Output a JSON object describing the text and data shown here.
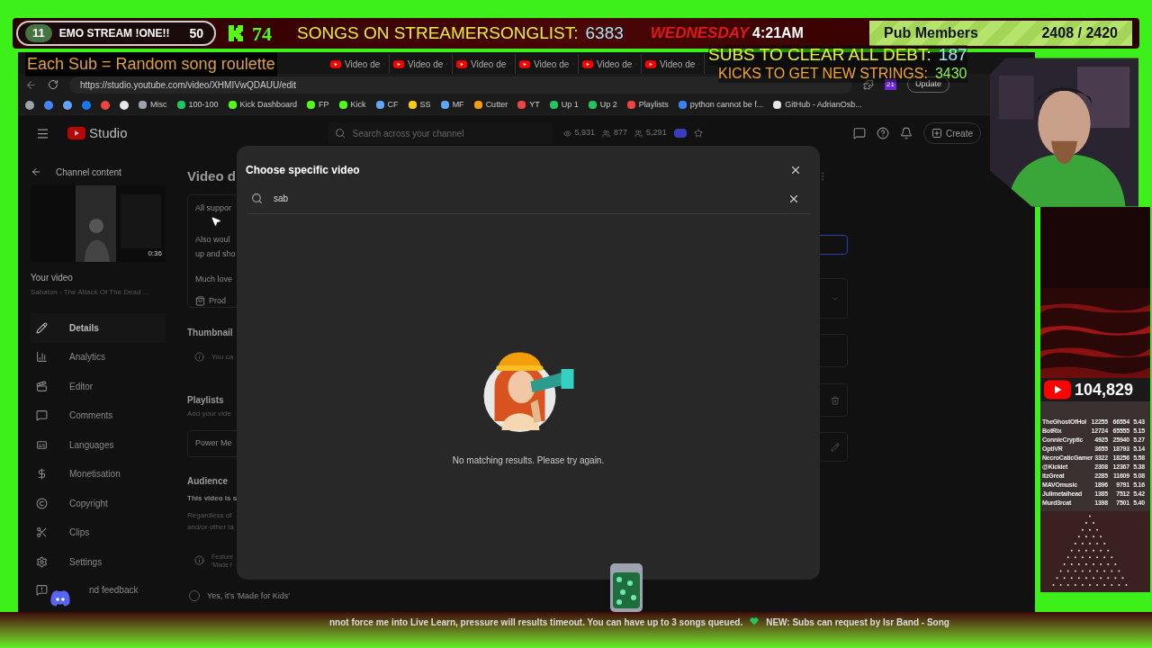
{
  "stream_bar": {
    "level_badge": "11",
    "title": "EMO STREAM !ONE!!",
    "title_count": "50",
    "kick_count": "74",
    "songs_label": "SONGS ON STREAMERSONGLIST:",
    "songs_count": "6383",
    "day": "WEDNESDAY",
    "time": "4:21AM",
    "members_label": "Pub Members",
    "members_count": "2408 / 2420"
  },
  "overlay_notes": {
    "roulette": "Each Sub = Random song roulette",
    "debt_label": "SUBS TO CLEAR ALL DEBT:",
    "debt_value": "187",
    "strings_label": "KICKS TO GET NEW STRINGS:",
    "strings_value": "3430"
  },
  "browser": {
    "tabs": [
      {
        "label": "Video de"
      },
      {
        "label": "Video de"
      },
      {
        "label": "Video de"
      },
      {
        "label": "Video de"
      },
      {
        "label": "Video de"
      },
      {
        "label": "Video de"
      }
    ],
    "url": "https://studio.youtube.com/video/XHMIVwQDAUU/edit",
    "update_button": "Update",
    "extensions_badge": "21",
    "bookmarks": [
      {
        "label": "Misc"
      },
      {
        "label": "100-100"
      },
      {
        "label": "Kick Dashboard"
      },
      {
        "label": "FP"
      },
      {
        "label": "Kick"
      },
      {
        "label": "CF"
      },
      {
        "label": "SS"
      },
      {
        "label": "MF"
      },
      {
        "label": "Cutter"
      },
      {
        "label": "YT"
      },
      {
        "label": "Up 1"
      },
      {
        "label": "Up 2"
      },
      {
        "label": "Playlists"
      },
      {
        "label": "python cannot be f..."
      },
      {
        "label": "GitHub - AdrianOsb..."
      }
    ]
  },
  "studio": {
    "logo_text": "Studio",
    "search_placeholder": "Search across your channel",
    "stats": [
      "5,931",
      "877",
      "5,291"
    ],
    "create_button": "Create",
    "sidebar": {
      "back_label": "Channel content",
      "duration": "0:36",
      "your_video": "Your video",
      "video_title": "Sabaton - The Attack Of The Dead ...",
      "items": [
        {
          "label": "Details",
          "selected": true
        },
        {
          "label": "Analytics",
          "selected": false
        },
        {
          "label": "Editor",
          "selected": false
        },
        {
          "label": "Comments",
          "selected": false
        },
        {
          "label": "Languages",
          "selected": false
        },
        {
          "label": "Monetisation",
          "selected": false
        },
        {
          "label": "Copyright",
          "selected": false
        },
        {
          "label": "Clips",
          "selected": false
        },
        {
          "label": "Settings",
          "selected": false
        }
      ],
      "feedback": "nd feedback"
    },
    "page": {
      "title": "Video d",
      "description_lines": [
        "All suppor",
        "Also woul",
        "up and sho",
        "Much love"
      ],
      "product_chip": "Prod",
      "thumbnail_heading": "Thumbnail",
      "thumbnail_note": "You ca",
      "playlists_heading": "Playlists",
      "playlists_note": "Add your vide",
      "playlist_value": "Power Me",
      "audience_heading": "Audience",
      "audience_line": "This video is s",
      "audience_note_lines": [
        "Regardless of",
        "and/or other la"
      ],
      "feature_note_lines": [
        "Feature",
        "'Made f"
      ],
      "made_for_kids": {
        "label": "Yes, it's 'Made for Kids'",
        "checked": false
      }
    }
  },
  "dialog": {
    "title": "Choose specific video",
    "search_value": "sab",
    "empty_message": "No matching results. Please try again."
  },
  "side_panel": {
    "youtube_subscribers": "104,829",
    "leaderboard": [
      {
        "name": "TheGhostOfHol",
        "points": "12255",
        "total": "66554",
        "ratio": "5.43"
      },
      {
        "name": "BotRix",
        "points": "12724",
        "total": "65555",
        "ratio": "5.15"
      },
      {
        "name": "ConnieCryptic",
        "points": "4925",
        "total": "25940",
        "ratio": "5.27"
      },
      {
        "name": "OptiVR",
        "points": "3655",
        "total": "18793",
        "ratio": "5.14"
      },
      {
        "name": "NecroCaticGamer",
        "points": "3322",
        "total": "18256",
        "ratio": "5.58"
      },
      {
        "name": "@Kicklet",
        "points": "2308",
        "total": "12367",
        "ratio": "5.38"
      },
      {
        "name": "itzGreat",
        "points": "2285",
        "total": "11609",
        "ratio": "5.08"
      },
      {
        "name": "MAVOmusic",
        "points": "1896",
        "total": "9791",
        "ratio": "5.16"
      },
      {
        "name": "Julimetalhead",
        "points": "1385",
        "total": "7512",
        "ratio": "5.42"
      },
      {
        "name": "Murd3rcat",
        "points": "1398",
        "total": "7501",
        "ratio": "5.40"
      }
    ]
  },
  "ticker": [
    "nnot force me into Live Learn, pressure will results timeout. You can have up to 3 songs queued.",
    "NEW: Subs can request by Isr Band - Song"
  ]
}
